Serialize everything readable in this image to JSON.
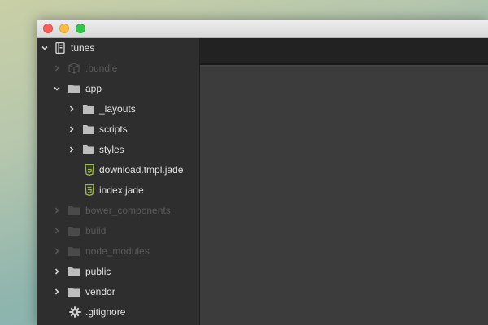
{
  "window": {
    "controls": [
      "close",
      "minimize",
      "zoom"
    ]
  },
  "tree": {
    "root": {
      "label": "tunes",
      "icon": "repo-icon",
      "expanded": true
    },
    "items": [
      {
        "label": ".bundle",
        "icon": "package-icon",
        "dim": true
      },
      {
        "label": "app",
        "icon": "folder-icon",
        "expanded": true
      },
      {
        "label": "_layouts",
        "icon": "folder-icon"
      },
      {
        "label": "scripts",
        "icon": "folder-icon"
      },
      {
        "label": "styles",
        "icon": "folder-icon"
      },
      {
        "label": "download.tmpl.jade",
        "icon": "html5-file-icon"
      },
      {
        "label": "index.jade",
        "icon": "html5-file-icon"
      },
      {
        "label": "bower_components",
        "icon": "folder-icon",
        "dim": true
      },
      {
        "label": "build",
        "icon": "folder-icon",
        "dim": true
      },
      {
        "label": "node_modules",
        "icon": "folder-icon",
        "dim": true
      },
      {
        "label": "public",
        "icon": "folder-icon"
      },
      {
        "label": "vendor",
        "icon": "folder-icon"
      },
      {
        "label": ".gitignore",
        "icon": "gear-icon"
      }
    ]
  },
  "colors": {
    "sidebar_bg": "#2e2e2e",
    "editor_bg": "#3c3c3c",
    "tabbar_bg": "#222222",
    "text": "#e1e1e1",
    "text_dim": "#5a5a5a",
    "html5_icon": "#9ab84a"
  }
}
